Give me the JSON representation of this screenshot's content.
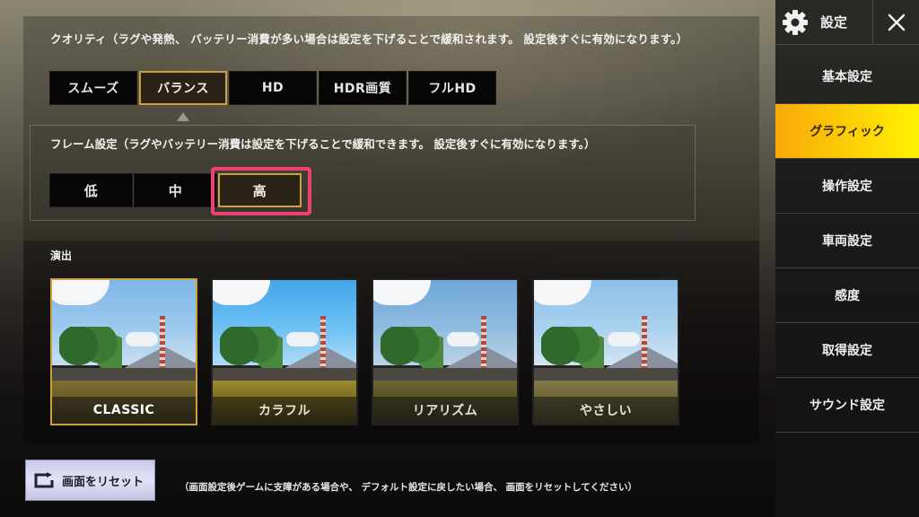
{
  "quality": {
    "label": "クオリティ（ラグや発熱、 バッテリー消費が多い場合は設定を下げることで緩和されます。 設定後すぐに有効になります。）",
    "options": [
      "スムーズ",
      "バランス",
      "HD",
      "HDR画質",
      "フルHD"
    ],
    "selected": "バランス"
  },
  "frame": {
    "label": "フレーム設定（ラグやバッテリー消費は設定を下げることで緩和できます。 設定後すぐに有効になります。）",
    "options": [
      "低",
      "中",
      "高"
    ],
    "selected": "高"
  },
  "effects": {
    "label": "演出",
    "options": [
      "CLASSIC",
      "カラフル",
      "リアリズム",
      "やさしい"
    ],
    "selected": "CLASSIC"
  },
  "reset": {
    "button_label": "画面をリセット",
    "note": "（画面設定後ゲームに支障がある場合や、 デフォルト設定に戻したい場合、 画面をリセットしてください）"
  },
  "sidebar": {
    "title": "設定",
    "items": [
      {
        "label": "基本設定",
        "active": false
      },
      {
        "label": "グラフィック",
        "active": true
      },
      {
        "label": "操作設定",
        "active": false
      },
      {
        "label": "車両設定",
        "active": false
      },
      {
        "label": "感度",
        "active": false
      },
      {
        "label": "取得設定",
        "active": false
      },
      {
        "label": "サウンド設定",
        "active": false
      }
    ]
  },
  "colors": {
    "accent_gold": "#c9a23d",
    "highlight_pink": "#ef3f74",
    "sidebar_active_start": "#f7a806",
    "sidebar_active_end": "#fff200"
  }
}
